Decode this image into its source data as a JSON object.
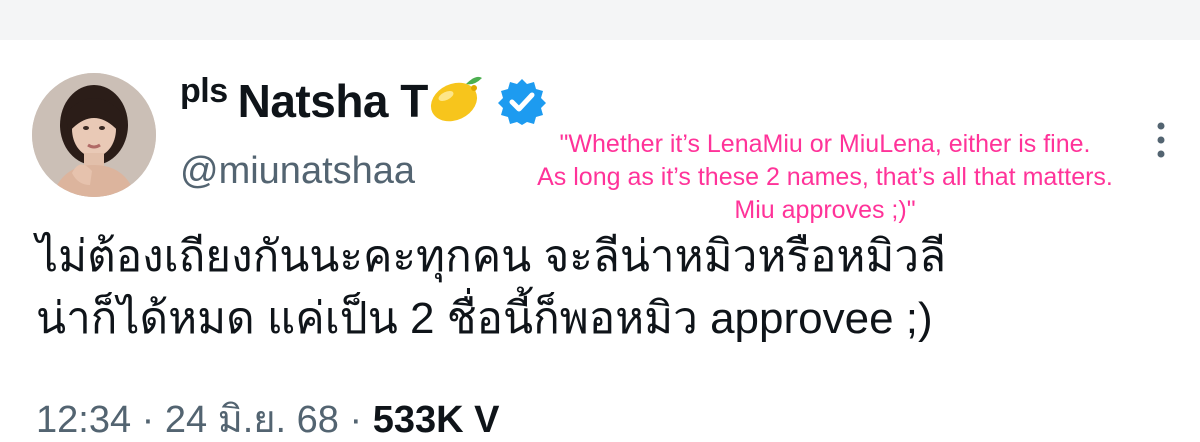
{
  "author": {
    "name_prefix": "pls",
    "name": "Natsha T",
    "name_emoji": "lemon-icon",
    "verified_icon": "verified-badge-icon",
    "handle": "@miunatshaa"
  },
  "overlay_translation": {
    "line1": "\"Whether it’s LenaMiu or MiuLena, either is fine.",
    "line2": "As long as it’s these 2 names, that’s all that matters.",
    "line3": "Miu approves ;)\"",
    "color": "#ff3399"
  },
  "tweet": {
    "line1": "ไม่ต้องเถียงกันนะคะทุกคน จะลีน่าหมิวหรือหมิวลี",
    "line2": "น่าก็ได้หมด แค่เป็น 2 ชื่อนี้ก็พอหมิว approvee ;)"
  },
  "meta": {
    "partial_text": "12:34 · 24 มิ.ย. 68 ·",
    "views_partial": "533K V"
  },
  "colors": {
    "text": "#0f1419",
    "secondary": "#536471",
    "verified": "#1d9bf0",
    "lemon": "#f7c51c"
  }
}
